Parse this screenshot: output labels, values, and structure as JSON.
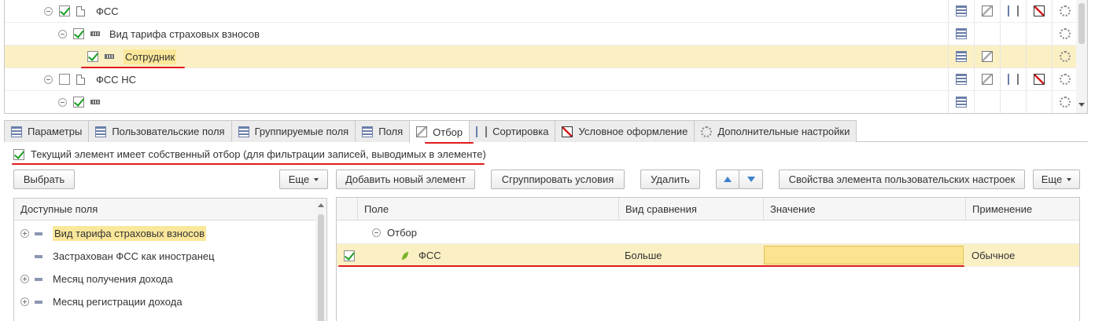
{
  "tree": {
    "rows": [
      {
        "label": "ФСС",
        "checked": true,
        "toggle": "minus",
        "icon": "document"
      },
      {
        "label": "Вид тарифа страховых взносов",
        "checked": true,
        "toggle": "minus",
        "icon": "grouping"
      },
      {
        "label": "Сотрудник",
        "checked": true,
        "toggle": "none",
        "icon": "grouping",
        "selected": true
      },
      {
        "label": "ФСС НС",
        "checked": false,
        "toggle": "minus",
        "icon": "document"
      },
      {
        "label": "",
        "checked": true,
        "toggle": "minus",
        "icon": "grouping"
      }
    ],
    "row_icons": [
      "fields-icon",
      "filter-icon",
      "sort-icon",
      "conditional-format-icon",
      "settings-icon"
    ]
  },
  "tabs": [
    {
      "label": "Параметры",
      "icon": "params-icon"
    },
    {
      "label": "Пользовательские поля",
      "icon": "user-fields-icon"
    },
    {
      "label": "Группируемые поля",
      "icon": "grouping-fields-icon"
    },
    {
      "label": "Поля",
      "icon": "fields-icon"
    },
    {
      "label": "Отбор",
      "icon": "filter-icon",
      "active": true
    },
    {
      "label": "Сортировка",
      "icon": "sort-icon"
    },
    {
      "label": "Условное оформление",
      "icon": "conditional-format-icon"
    },
    {
      "label": "Дополнительные настройки",
      "icon": "settings-icon"
    }
  ],
  "own_filter": {
    "checked": true,
    "label": "Текущий элемент имеет собственный отбор (для фильтрации записей, выводимых в элементе)"
  },
  "left_toolbar": {
    "select": "Выбрать",
    "more": "Еще"
  },
  "right_toolbar": {
    "add": "Добавить новый элемент",
    "group": "Сгруппировать условия",
    "delete": "Удалить",
    "properties": "Свойства элемента пользовательских настроек",
    "more": "Еще"
  },
  "available_fields": {
    "header": "Доступные поля",
    "items": [
      {
        "label": "Вид тарифа страховых взносов",
        "expandable": true,
        "highlight": true
      },
      {
        "label": "Застрахован ФСС как иностранец",
        "expandable": false
      },
      {
        "label": "Месяц получения дохода",
        "expandable": true
      },
      {
        "label": "Месяц регистрации дохода",
        "expandable": true
      }
    ]
  },
  "filter_table": {
    "columns": [
      "Поле",
      "Вид сравнения",
      "Значение",
      "Применение"
    ],
    "group_label": "Отбор",
    "rows": [
      {
        "checked": true,
        "field": "ФСС",
        "comparison": "Больше",
        "value": "",
        "application": "Обычное"
      }
    ]
  },
  "colors": {
    "selection": "#fbf0c4",
    "highlight": "#fbe79a",
    "annotation": "#e01b1b",
    "check": "#1a9e24"
  }
}
